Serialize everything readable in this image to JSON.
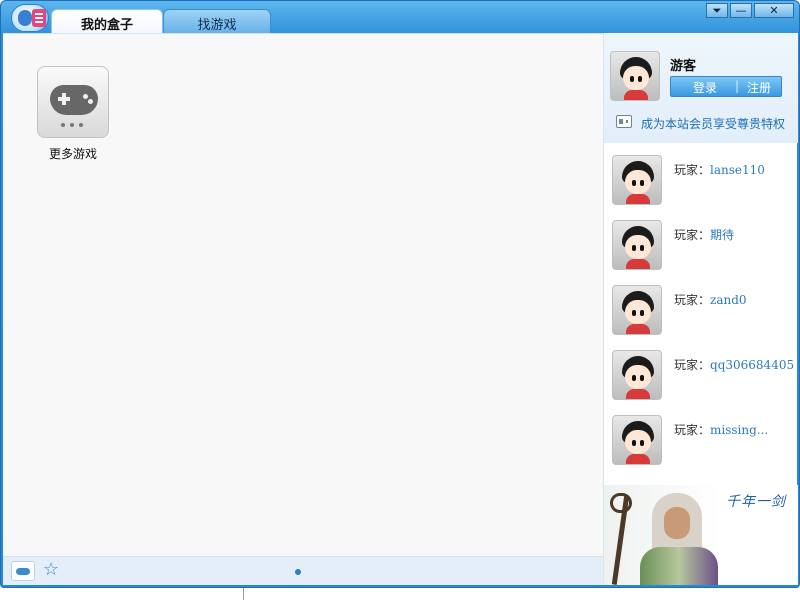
{
  "tabs": [
    {
      "label": "我的盒子",
      "active": true
    },
    {
      "label": "找游戏",
      "active": false
    }
  ],
  "window_controls": {
    "menu": "⏷",
    "minimize": "—",
    "close": "✕"
  },
  "main": {
    "games": [
      {
        "label": "更多游戏",
        "icon": "gamepad-icon"
      }
    ]
  },
  "bottom_bar": {
    "icons": [
      "gamepad-icon",
      "star-icon"
    ],
    "star_glyph": "☆",
    "page_indicator": {
      "current": 1,
      "total": 1
    }
  },
  "sidebar": {
    "profile": {
      "username": "游客",
      "login_label": "登录",
      "separator": "|",
      "register_label": "注册",
      "vip_text": "成为本站会员享受尊贵特权"
    },
    "players": [
      {
        "prefix": "玩家：",
        "name": "lanse110"
      },
      {
        "prefix": "玩家：",
        "name": "期待"
      },
      {
        "prefix": "玩家：",
        "name": "zand0"
      },
      {
        "prefix": "玩家：",
        "name": "qq306684405"
      },
      {
        "prefix": "玩家：",
        "name": "missing..."
      }
    ],
    "ad_banner": {
      "logo_text": "千年一剑"
    }
  },
  "colors": {
    "title_bar": "#2e8fd8",
    "accent": "#2a79c2",
    "button": "#3a98e0"
  }
}
